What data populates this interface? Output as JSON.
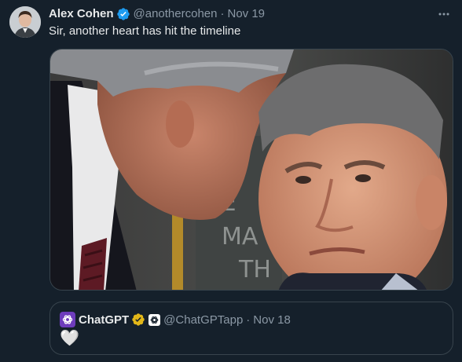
{
  "tweet": {
    "display_name": "Alex Cohen",
    "handle": "@anothercohen",
    "separator": "·",
    "date": "Nov 19",
    "text": "Sir, another heart has hit the timeline",
    "verified_icon": "verified-badge-icon",
    "more_icon": "more-options-icon"
  },
  "media": {
    "board_text": [
      "KE",
      "MA",
      "TH"
    ]
  },
  "quoted_tweet": {
    "display_name": "ChatGPT",
    "handle": "@ChatGPTapp",
    "separator": "·",
    "date": "Nov 18",
    "body": "🤍",
    "badge_icon": "gold-verified-badge-icon",
    "affiliate_icon": "openai-affiliate-icon"
  },
  "colors": {
    "background": "#15202b",
    "border": "#38444d",
    "muted": "#8b98a5",
    "verified_blue": "#1d9bf0",
    "verified_gold": "#e2b719",
    "chatgpt_purple": "#6e3cbc"
  }
}
